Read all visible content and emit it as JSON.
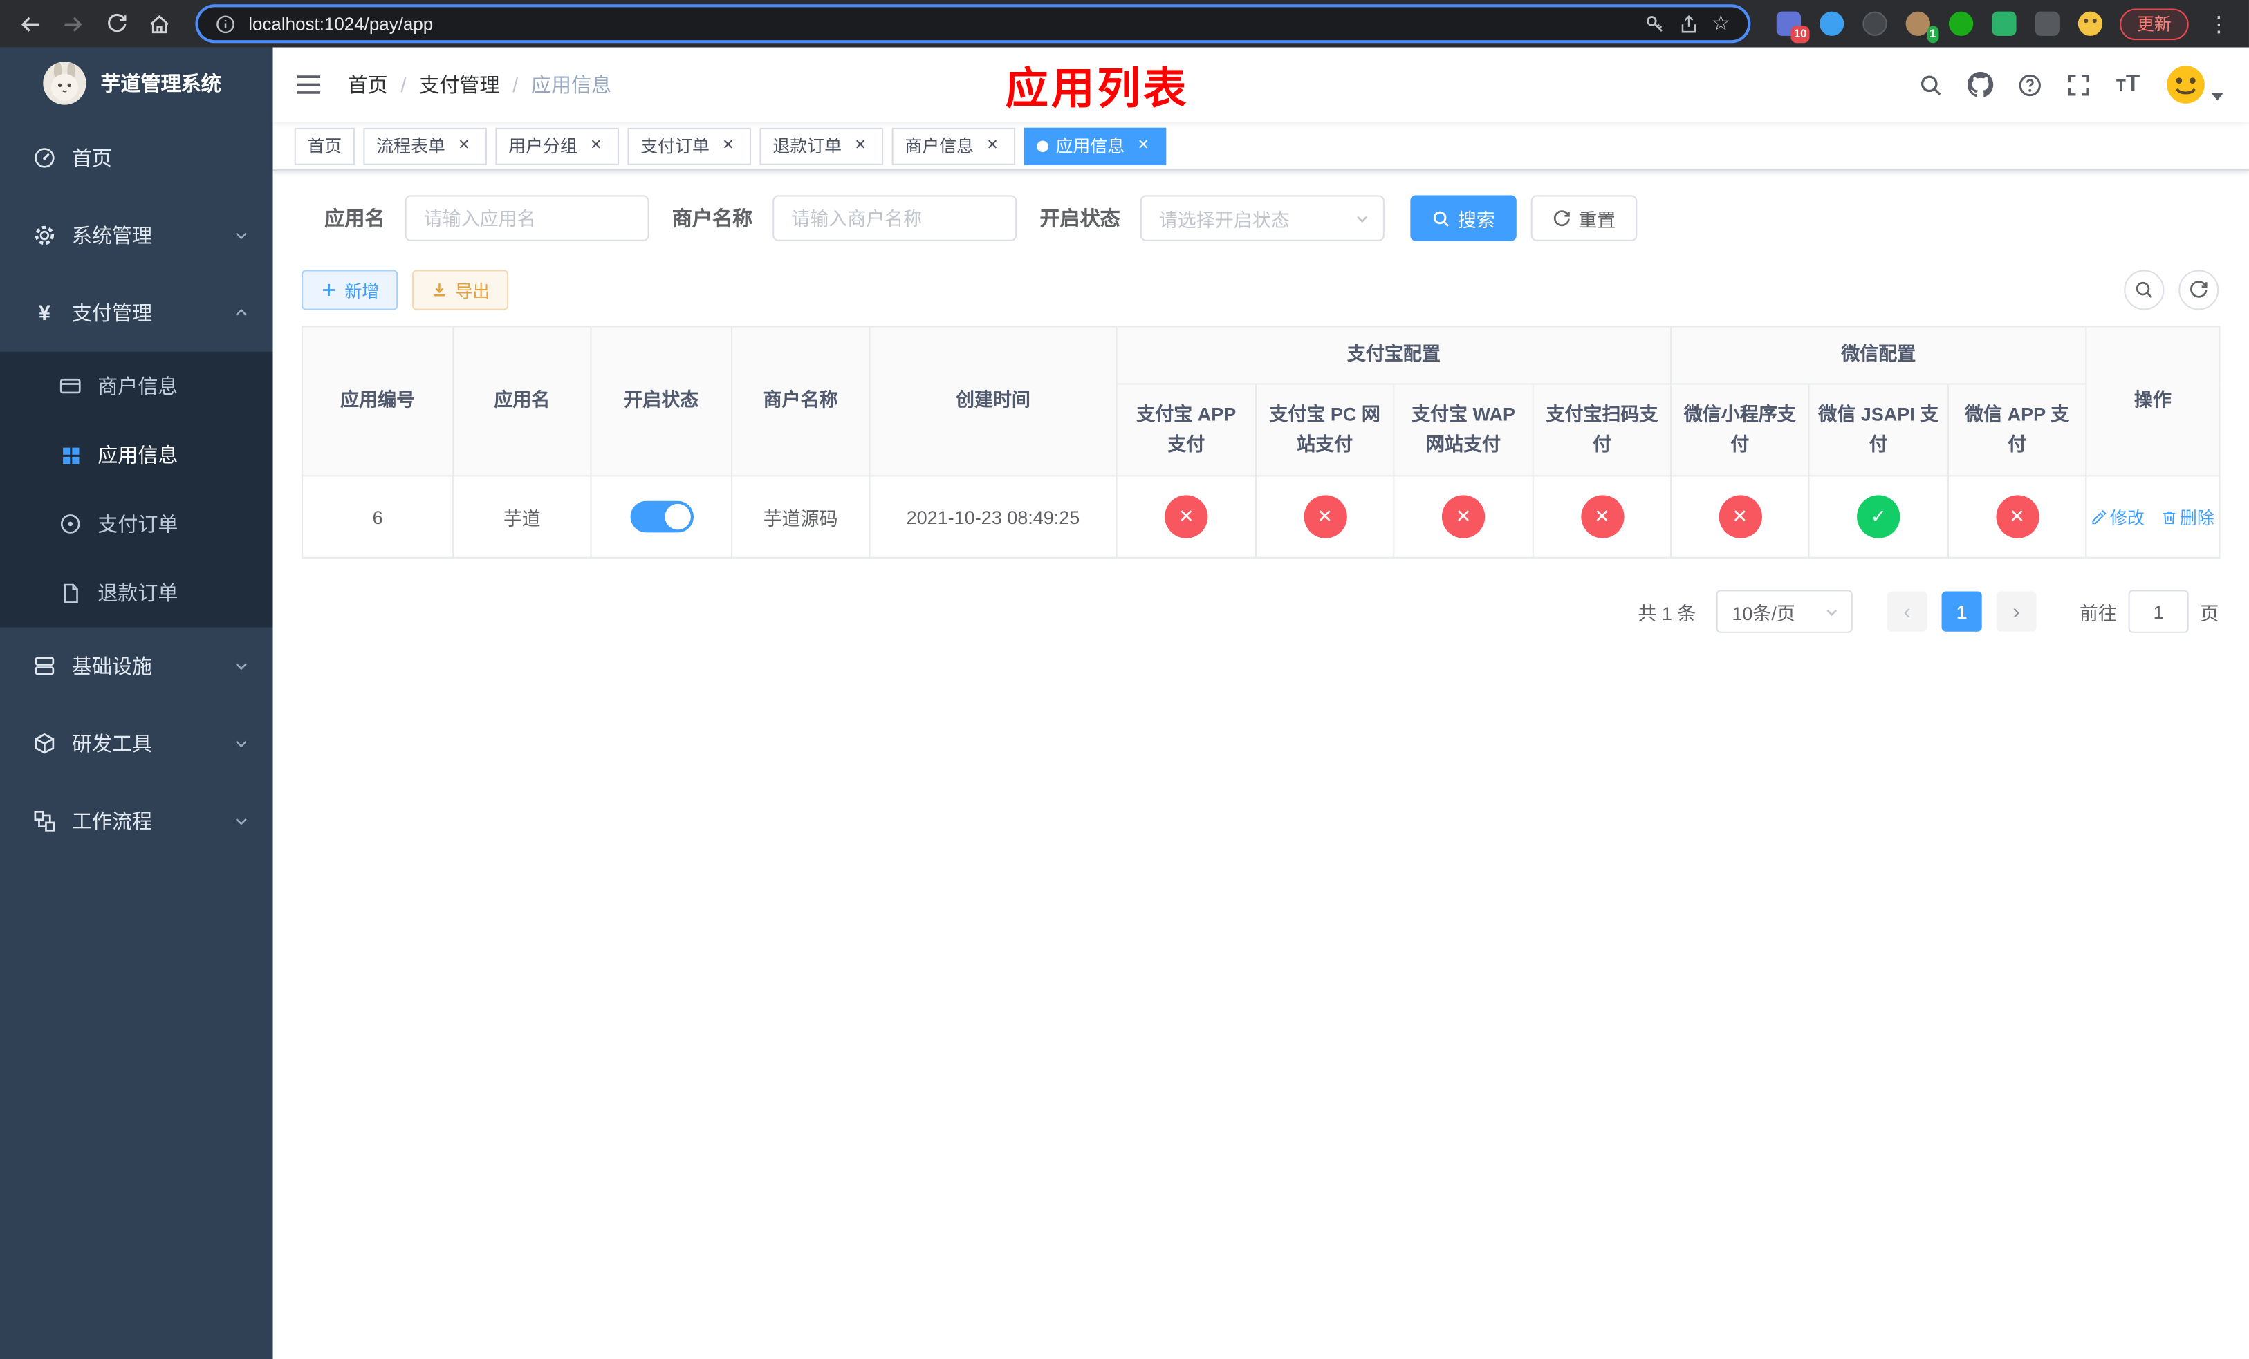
{
  "browser": {
    "url": "localhost:1024/pay/app",
    "update_label": "更新",
    "extensions": [
      {
        "name": "extension-blue-square",
        "badge": "10"
      },
      {
        "name": "extension-blue-drop",
        "badge": ""
      },
      {
        "name": "extension-dark-circle",
        "badge": ""
      },
      {
        "name": "extension-avatar-circle",
        "badge": "1"
      },
      {
        "name": "extension-green-circle",
        "badge": ""
      },
      {
        "name": "extension-green-square",
        "badge": ""
      },
      {
        "name": "extension-gray-pin",
        "badge": ""
      },
      {
        "name": "extension-smiley",
        "badge": ""
      }
    ]
  },
  "colors": {
    "accent": "#409eff",
    "success": "#13ce66",
    "danger": "#f8575f",
    "sidebar_bg": "#304156",
    "sidebar_submenu_bg": "#1f2d3d",
    "page_title_red": "#ff0000"
  },
  "sidebar": {
    "logo_title": "芋道管理系统",
    "menu": [
      {
        "label": "首页"
      },
      {
        "label": "系统管理"
      },
      {
        "label": "支付管理",
        "expanded": true,
        "children": [
          {
            "label": "商户信息"
          },
          {
            "label": "应用信息",
            "active": true
          },
          {
            "label": "支付订单"
          },
          {
            "label": "退款订单"
          }
        ]
      },
      {
        "label": "基础设施"
      },
      {
        "label": "研发工具"
      },
      {
        "label": "工作流程"
      }
    ]
  },
  "navbar": {
    "breadcrumb": [
      "首页",
      "支付管理",
      "应用信息"
    ],
    "page_title": "应用列表"
  },
  "tags": [
    {
      "label": "首页",
      "closable": false,
      "active": false
    },
    {
      "label": "流程表单",
      "closable": true,
      "active": false
    },
    {
      "label": "用户分组",
      "closable": true,
      "active": false
    },
    {
      "label": "支付订单",
      "closable": true,
      "active": false
    },
    {
      "label": "退款订单",
      "closable": true,
      "active": false
    },
    {
      "label": "商户信息",
      "closable": true,
      "active": false
    },
    {
      "label": "应用信息",
      "closable": true,
      "active": true
    }
  ],
  "filters": {
    "app_name": {
      "label": "应用名",
      "placeholder": "请输入应用名",
      "value": ""
    },
    "merchant": {
      "label": "商户名称",
      "placeholder": "请输入商户名称",
      "value": ""
    },
    "status": {
      "label": "开启状态",
      "placeholder": "请选择开启状态",
      "value": ""
    },
    "search_label": "搜索",
    "reset_label": "重置"
  },
  "toolbar": {
    "add_label": "新增",
    "export_label": "导出"
  },
  "table": {
    "groups": {
      "alipay": "支付宝配置",
      "wechat": "微信配置"
    },
    "headers": [
      "应用编号",
      "应用名",
      "开启状态",
      "商户名称",
      "创建时间",
      "支付宝 APP 支付",
      "支付宝 PC 网站支付",
      "支付宝 WAP 网站支付",
      "支付宝扫码支付",
      "微信小程序支付",
      "微信 JSAPI 支付",
      "微信 APP 支付",
      "操作"
    ],
    "row": {
      "app_id": "6",
      "app_name": "芋道",
      "status_on": true,
      "merchant_name": "芋道源码",
      "create_time": "2021-10-23 08:49:25",
      "channels": [
        "disabled",
        "disabled",
        "disabled",
        "disabled",
        "disabled",
        "enabled",
        "disabled"
      ],
      "edit_label": "修改",
      "delete_label": "删除"
    }
  },
  "pagination": {
    "total_text": "共 1 条",
    "page_size": "10条/页",
    "current_page": "1",
    "goto_label": "前往",
    "goto_value": "1",
    "page_unit": "页"
  }
}
